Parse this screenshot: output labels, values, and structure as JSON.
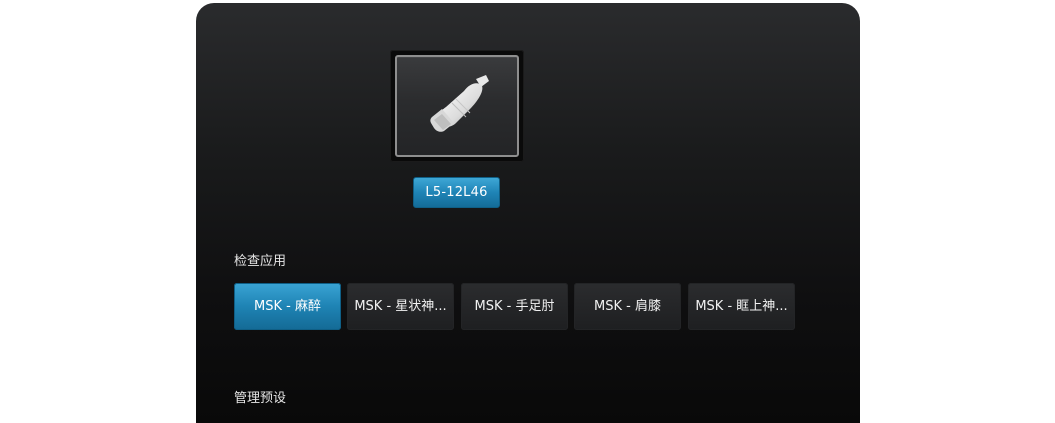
{
  "probe": {
    "icon": "linear-probe-icon",
    "name": "L5-12L46"
  },
  "exam_apps": {
    "label": "检查应用",
    "items": [
      {
        "label": "MSK - 麻醉",
        "selected": true
      },
      {
        "label": "MSK - 星状神...",
        "selected": false
      },
      {
        "label": "MSK - 手足肘",
        "selected": false
      },
      {
        "label": "MSK - 肩膝",
        "selected": false
      },
      {
        "label": "MSK - 眶上神...",
        "selected": false
      }
    ]
  },
  "presets": {
    "label": "管理预设"
  },
  "colors": {
    "accent": "#1f84b6",
    "panel_bg": "#1a1b1c",
    "button_bg": "#252628",
    "text": "#f2f2f2"
  }
}
